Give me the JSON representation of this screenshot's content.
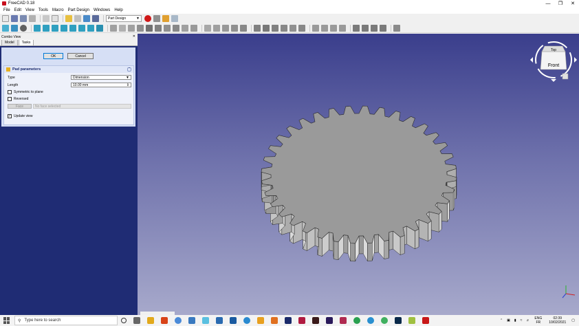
{
  "window": {
    "title": "FreeCAD 0.18"
  },
  "menu": [
    "File",
    "Edit",
    "View",
    "Tools",
    "Macro",
    "Part Design",
    "Windows",
    "Help"
  ],
  "toolbar": {
    "workbench": "Part Design"
  },
  "combo_view": {
    "title": "Combo View",
    "tabs": [
      "Model",
      "Tasks"
    ],
    "ok_label": "OK",
    "cancel_label": "Cancel",
    "pad_panel": {
      "title": "Pad parameters",
      "type_label": "Type",
      "type_value": "Dimension",
      "length_label": "Length",
      "length_value": "10.00 mm",
      "symmetric_label": "Symmetric to plane",
      "symmetric_checked": false,
      "reversed_label": "Reversed",
      "reversed_checked": false,
      "face_button": "Face",
      "face_placeholder": "No face selected",
      "update_label": "Update view",
      "update_checked": true
    }
  },
  "navcube": {
    "top": "Top",
    "front": "Front"
  },
  "taskbar": {
    "search_placeholder": "Type here to search",
    "lang_top": "ENG",
    "lang_bottom": "FR",
    "time": "02:39",
    "date": "10/02/2021"
  },
  "colors": {
    "task_panel": "#d6dff5",
    "combo_bg": "#1f2c74",
    "view_top": "#3a3e8c",
    "view_bottom": "#a7a9cb",
    "gear": "#9a9a9a",
    "record": "#d01818"
  }
}
